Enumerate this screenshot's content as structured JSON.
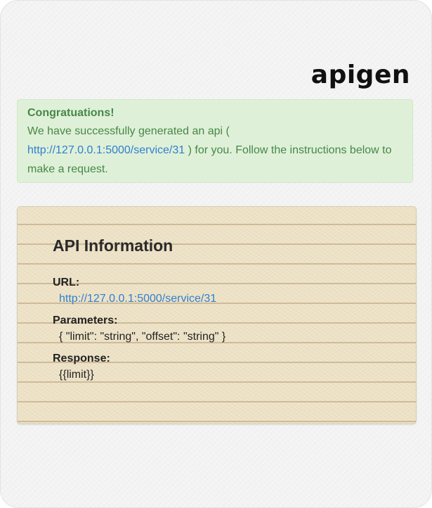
{
  "brand": {
    "logo_text": "apigen"
  },
  "alert": {
    "title": "Congratuations!",
    "text_before_link": "We have successfully generated an api (",
    "link_text": "http://127.0.0.1:5000/service/31",
    "text_after_link": ") for you. Follow the instructions below to make a request."
  },
  "api_info": {
    "title": "API Information",
    "url_label": "URL:",
    "url_value": "http://127.0.0.1:5000/service/31",
    "parameters_label": "Parameters:",
    "parameters_value": "{ \"limit\": \"string\", \"offset\": \"string\" }",
    "response_label": "Response:",
    "response_value": "{{limit}}"
  }
}
